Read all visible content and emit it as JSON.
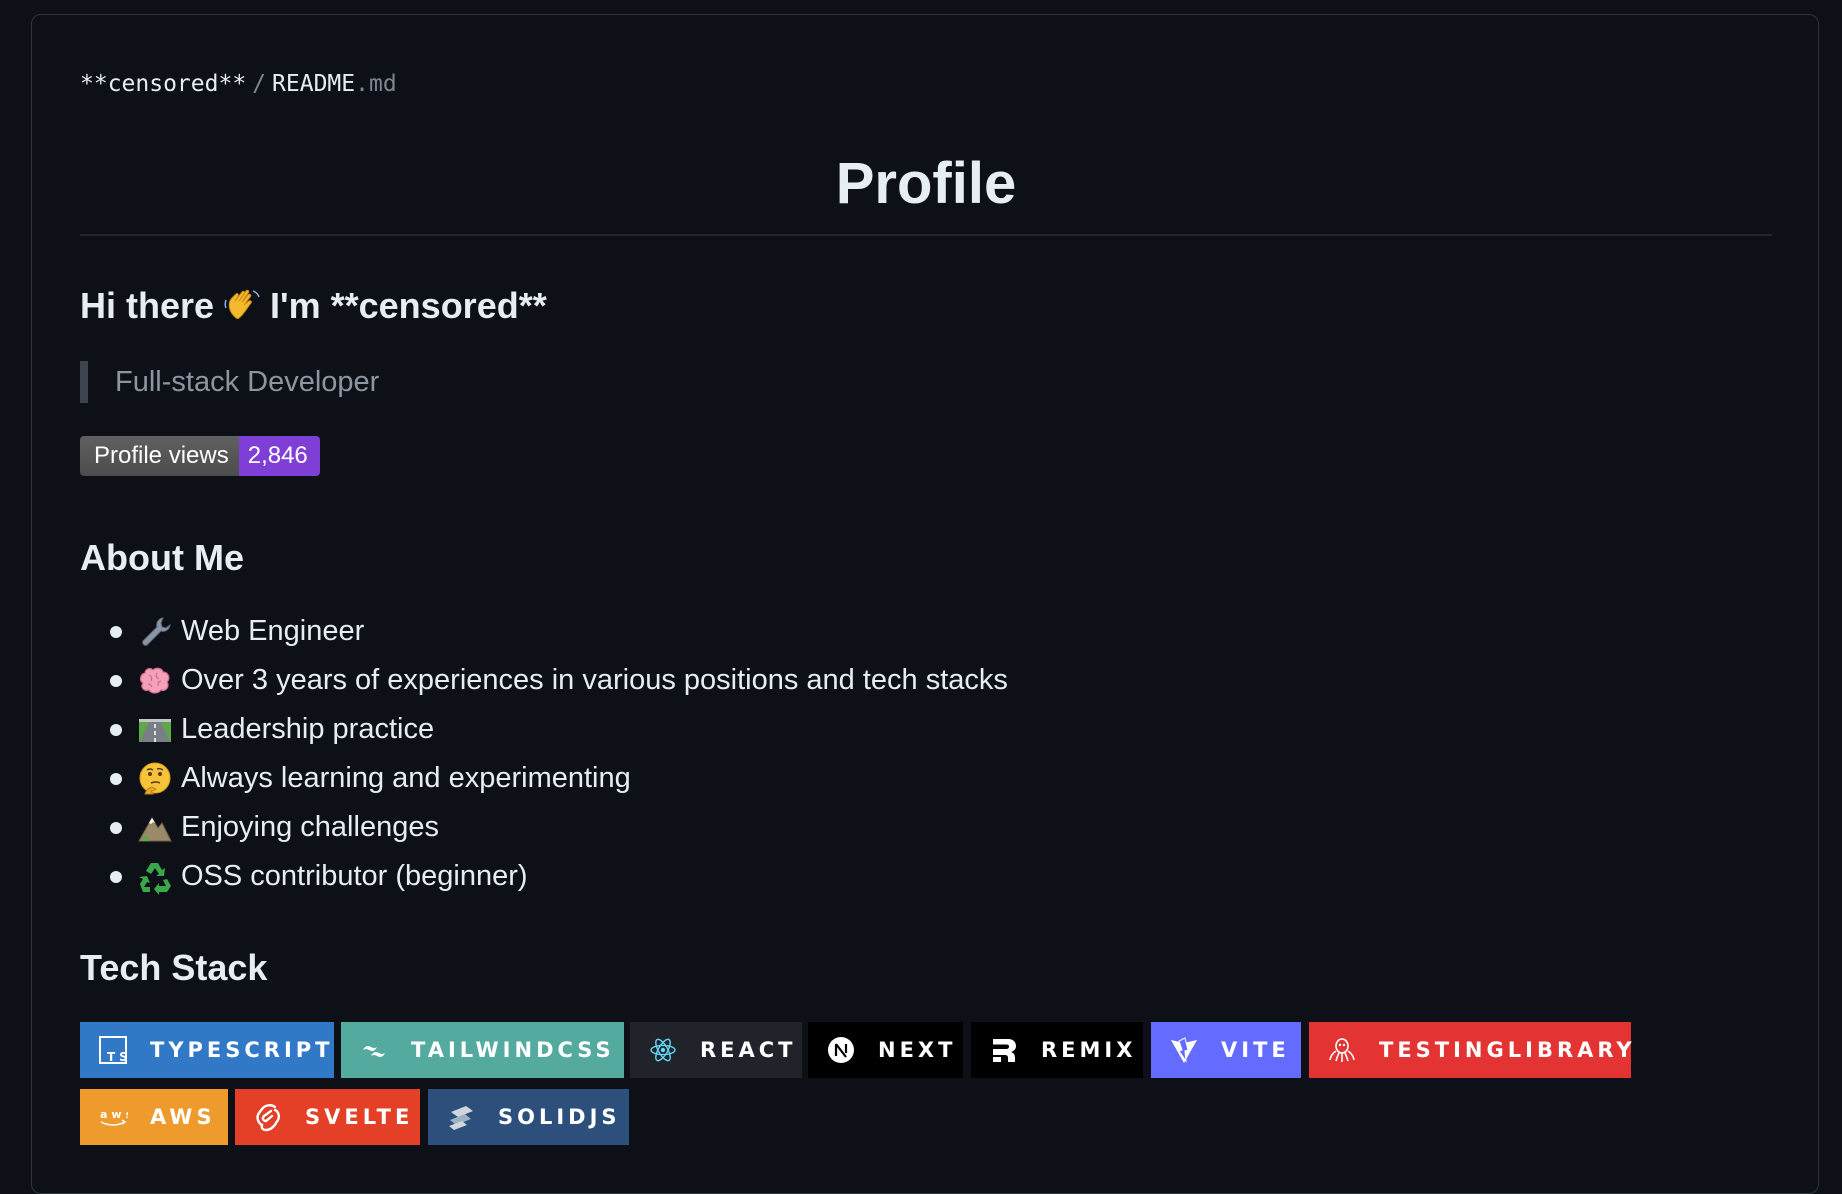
{
  "breadcrumb": {
    "owner": "**censored**",
    "separator": "/",
    "file": "README",
    "ext": ".md"
  },
  "title": "Profile",
  "greeting": {
    "prefix": "Hi there",
    "emoji": "waving-hand-icon",
    "suffix": "I'm **censored**"
  },
  "quote": "Full-stack Developer",
  "profile_views": {
    "label": "Profile views",
    "count": "2,846",
    "color": "#7f3fd6"
  },
  "about": {
    "heading": "About Me",
    "items": [
      {
        "icon": "wrench-icon",
        "text": "Web Engineer"
      },
      {
        "icon": "brain-icon",
        "text": "Over 3 years of experiences in various positions and tech stacks"
      },
      {
        "icon": "motorway-icon",
        "text": "Leadership practice"
      },
      {
        "icon": "thinking-face-icon",
        "text": "Always learning and experimenting"
      },
      {
        "icon": "mountain-icon",
        "text": "Enjoying challenges"
      },
      {
        "icon": "recycle-icon",
        "text": "OSS contributor (beginner)"
      }
    ]
  },
  "tech": {
    "heading": "Tech Stack",
    "badges": [
      {
        "label": "TYPESCRIPT",
        "icon": "typescript-icon",
        "color": "#3178c6"
      },
      {
        "label": "TAILWINDCSS",
        "icon": "tailwindcss-icon",
        "color": "#55aaa0"
      },
      {
        "label": "REACT",
        "icon": "react-icon",
        "color": "#20232a"
      },
      {
        "label": "NEXT",
        "icon": "nextjs-icon",
        "color": "#000000"
      },
      {
        "label": "REMIX",
        "icon": "remix-icon",
        "color": "#000000"
      },
      {
        "label": "VITE",
        "icon": "vite-icon",
        "color": "#646cff"
      },
      {
        "label": "TESTINGLIBRARY",
        "icon": "testinglibrary-icon",
        "color": "#e33332"
      },
      {
        "label": "AWS",
        "icon": "aws-icon",
        "color": "#ef9a2d"
      },
      {
        "label": "SVELTE",
        "icon": "svelte-icon",
        "color": "#e34027"
      },
      {
        "label": "SOLIDJS",
        "icon": "solidjs-icon",
        "color": "#2c4f7c"
      }
    ]
  }
}
